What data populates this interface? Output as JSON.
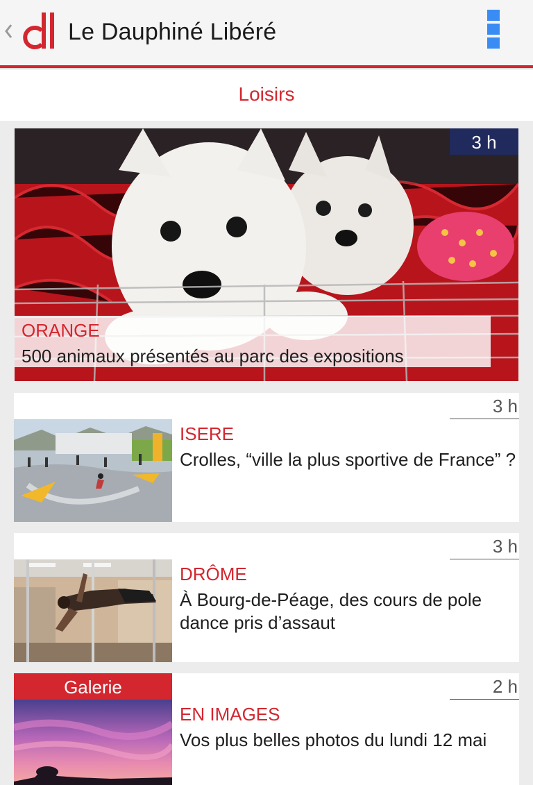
{
  "app": {
    "title": "Le Dauphiné Libéré",
    "logo_icon": "dl-logo-icon",
    "back_icon": "chevron-left-icon",
    "menu_icon": "overflow-menu-icon",
    "accent_color": "#d4262f",
    "menu_color": "#3a8cf5"
  },
  "section": {
    "title": "Loisirs"
  },
  "hero": {
    "time": "3 h",
    "region": "ORANGE",
    "headline": "500 animaux présentés au parc des expositions",
    "image": "puppies-photo"
  },
  "articles": [
    {
      "time": "3 h",
      "region": "ISERE",
      "headline": "Crolles, “ville la plus sportive de France” ?",
      "image": "skatepark-photo"
    },
    {
      "time": "3 h",
      "region": "DRÔME",
      "headline": "À Bourg-de-Péage, des cours de pole dance pris d’assaut",
      "image": "pole-dance-photo"
    },
    {
      "time": "2 h",
      "region": "EN IMAGES",
      "headline": "Vos plus belles photos du lundi 12 mai",
      "badge": "Galerie",
      "image": "sunset-photo"
    }
  ]
}
